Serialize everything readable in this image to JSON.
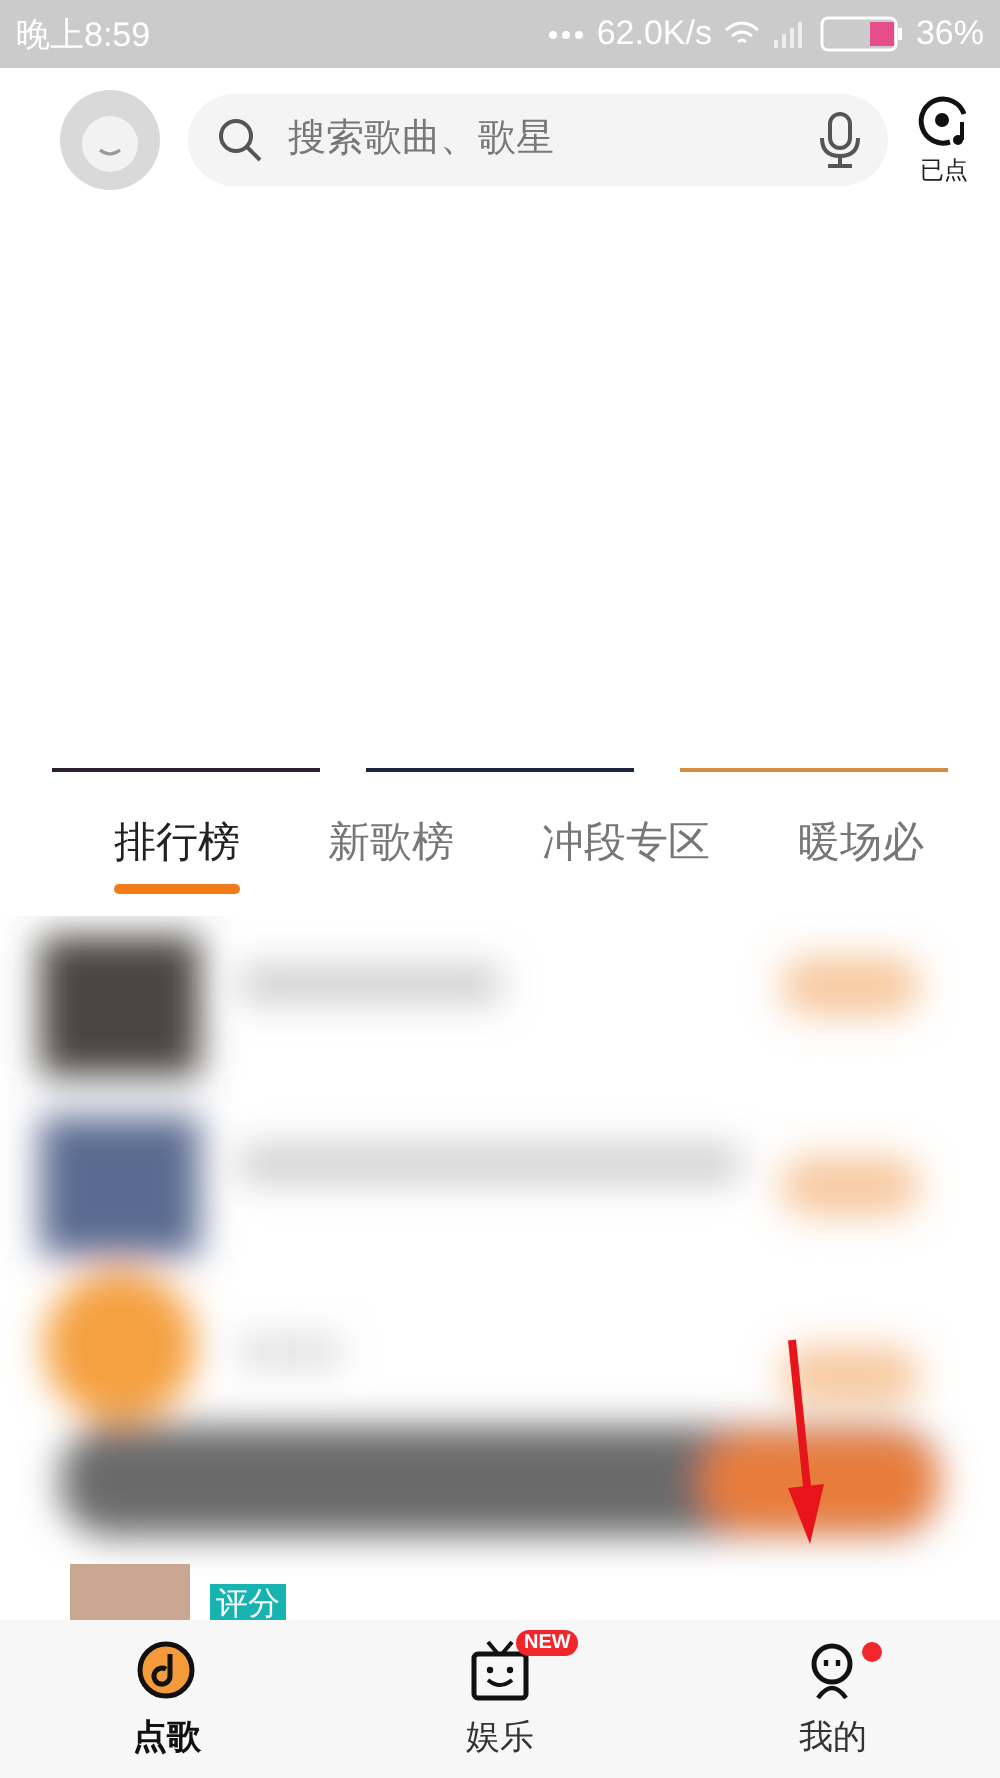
{
  "status_bar": {
    "time": "晚上8:59",
    "network_speed": "62.0K/s",
    "battery_text": "36%"
  },
  "header": {
    "search": {
      "placeholder": "搜索歌曲、歌星"
    },
    "queued_label": "已点"
  },
  "tabs": [
    {
      "label": "排行榜",
      "selected": true
    },
    {
      "label": "新歌榜",
      "selected": false
    },
    {
      "label": "冲段专区",
      "selected": false
    },
    {
      "label": "暖场必",
      "selected": false
    }
  ],
  "peek_row": {
    "tag": "评分"
  },
  "bottom_nav": [
    {
      "label": "点歌",
      "kind": "disc",
      "selected": true,
      "dot": false
    },
    {
      "label": "娱乐",
      "kind": "tv",
      "selected": false,
      "badge": "NEW",
      "dot": false
    },
    {
      "label": "我的",
      "kind": "person",
      "selected": false,
      "dot": true
    }
  ]
}
